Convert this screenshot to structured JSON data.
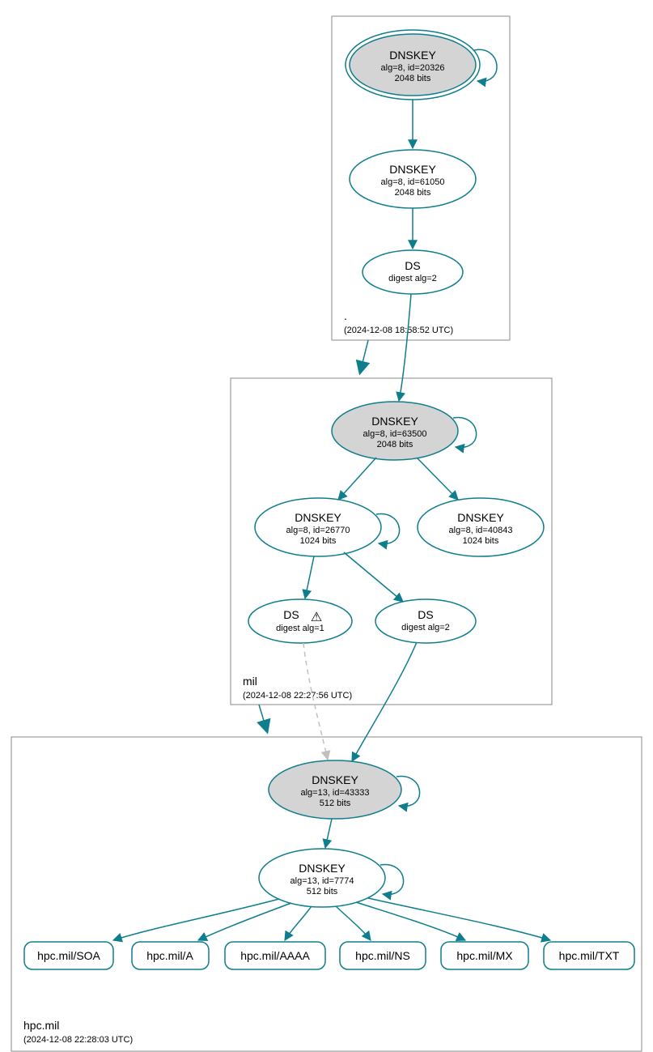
{
  "zones": {
    "root": {
      "label": ".",
      "timestamp": "(2024-12-08 18:58:52 UTC)"
    },
    "mil": {
      "label": "mil",
      "timestamp": "(2024-12-08 22:27:56 UTC)"
    },
    "hpc": {
      "label": "hpc.mil",
      "timestamp": "(2024-12-08 22:28:03 UTC)"
    }
  },
  "nodes": {
    "root_ksk": {
      "title": "DNSKEY",
      "line2": "alg=8, id=20326",
      "line3": "2048 bits"
    },
    "root_zsk": {
      "title": "DNSKEY",
      "line2": "alg=8, id=61050",
      "line3": "2048 bits"
    },
    "root_ds": {
      "title": "DS",
      "line2": "digest alg=2"
    },
    "mil_ksk": {
      "title": "DNSKEY",
      "line2": "alg=8, id=63500",
      "line3": "2048 bits"
    },
    "mil_zsk1": {
      "title": "DNSKEY",
      "line2": "alg=8, id=26770",
      "line3": "1024 bits"
    },
    "mil_zsk2": {
      "title": "DNSKEY",
      "line2": "alg=8, id=40843",
      "line3": "1024 bits"
    },
    "mil_ds1": {
      "title": "DS",
      "warn": "⚠",
      "line2": "digest alg=1"
    },
    "mil_ds2": {
      "title": "DS",
      "line2": "digest alg=2"
    },
    "hpc_ksk": {
      "title": "DNSKEY",
      "line2": "alg=13, id=43333",
      "line3": "512 bits"
    },
    "hpc_zsk": {
      "title": "DNSKEY",
      "line2": "alg=13, id=7774",
      "line3": "512 bits"
    }
  },
  "rr": {
    "soa": "hpc.mil/SOA",
    "a": "hpc.mil/A",
    "aaaa": "hpc.mil/AAAA",
    "ns": "hpc.mil/NS",
    "mx": "hpc.mil/MX",
    "txt": "hpc.mil/TXT"
  }
}
